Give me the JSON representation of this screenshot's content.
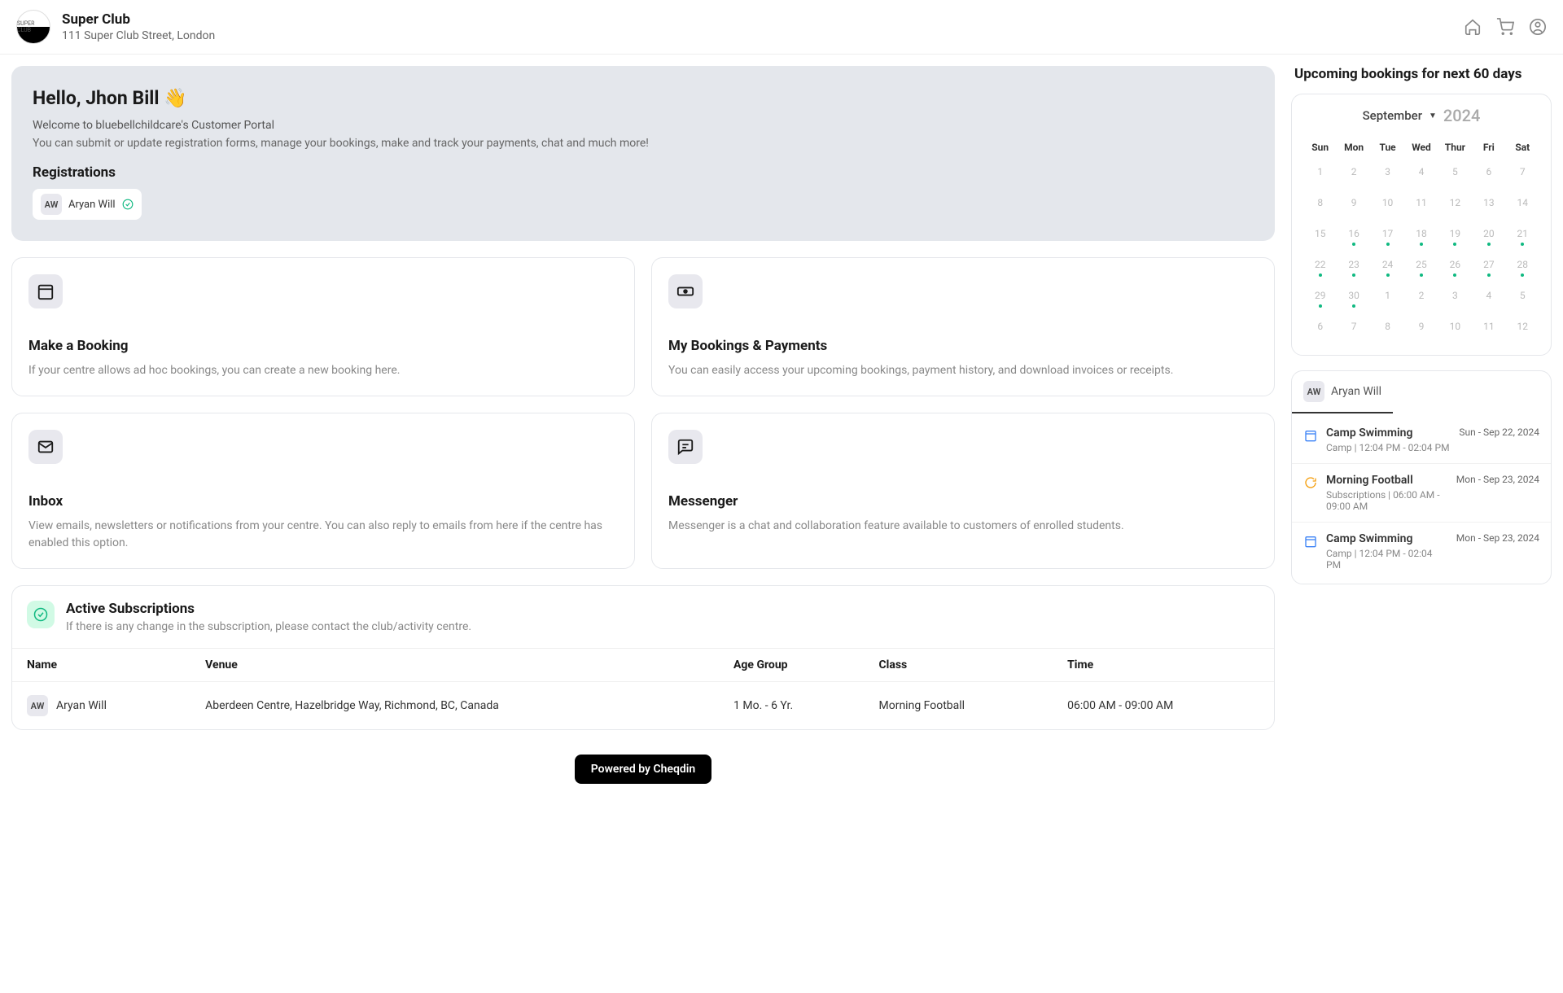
{
  "header": {
    "org_name": "Super Club",
    "org_address": "111 Super Club Street, London"
  },
  "hero": {
    "hello": "Hello, Jhon Bill 👋",
    "welcome": "Welcome to bluebellchildcare's Customer Portal",
    "welcome_sub": "You can submit or update registration forms, manage your bookings, make and track your payments, chat and much more!",
    "reg_title": "Registrations",
    "reg_initials": "AW",
    "reg_name": "Aryan Will"
  },
  "cards": [
    {
      "title": "Make a Booking",
      "desc": "If your centre allows ad hoc bookings, you can create a new booking here."
    },
    {
      "title": "My Bookings & Payments",
      "desc": "You can easily access your upcoming bookings, payment history, and download invoices or receipts."
    },
    {
      "title": "Inbox",
      "desc": "View emails, newsletters or notifications from your centre. You can also reply to emails from here if the centre has enabled this option."
    },
    {
      "title": "Messenger",
      "desc": "Messenger is a chat and collaboration feature available to customers of enrolled students."
    }
  ],
  "subs": {
    "title": "Active Subscriptions",
    "subtitle": "If there is any change in the subscription, please contact the club/activity centre.",
    "cols": {
      "name": "Name",
      "venue": "Venue",
      "age": "Age Group",
      "class": "Class",
      "time": "Time"
    },
    "rows": [
      {
        "initials": "AW",
        "name": "Aryan Will",
        "venue": "Aberdeen Centre, Hazelbridge Way, Richmond, BC, Canada",
        "age": "1 Mo. - 6 Yr.",
        "class": "Morning Football",
        "time": "06:00 AM - 09:00 AM"
      }
    ]
  },
  "powered": "Powered by Cheqdin",
  "side": {
    "title": "Upcoming bookings for next 60 days",
    "month": "September",
    "year": "2024",
    "dayhead": [
      "Sun",
      "Mon",
      "Tue",
      "Wed",
      "Thur",
      "Fri",
      "Sat"
    ],
    "weeks": [
      [
        {
          "n": 1
        },
        {
          "n": 2
        },
        {
          "n": 3
        },
        {
          "n": 4
        },
        {
          "n": 5
        },
        {
          "n": 6
        },
        {
          "n": 7
        }
      ],
      [
        {
          "n": 8
        },
        {
          "n": 9
        },
        {
          "n": 10
        },
        {
          "n": 11
        },
        {
          "n": 12
        },
        {
          "n": 13
        },
        {
          "n": 14
        }
      ],
      [
        {
          "n": 15
        },
        {
          "n": 16,
          "dot": true
        },
        {
          "n": 17,
          "dot": true
        },
        {
          "n": 18,
          "dot": true
        },
        {
          "n": 19,
          "dot": true
        },
        {
          "n": 20,
          "dot": true
        },
        {
          "n": 21,
          "dot": true
        }
      ],
      [
        {
          "n": 22,
          "dot": true
        },
        {
          "n": 23,
          "dot": true
        },
        {
          "n": 24,
          "dot": true
        },
        {
          "n": 25,
          "dot": true
        },
        {
          "n": 26,
          "dot": true
        },
        {
          "n": 27,
          "dot": true
        },
        {
          "n": 28,
          "dot": true
        }
      ],
      [
        {
          "n": 29,
          "dot": true
        },
        {
          "n": 30,
          "dot": true
        },
        {
          "n": 1
        },
        {
          "n": 2
        },
        {
          "n": 3
        },
        {
          "n": 4
        },
        {
          "n": 5
        }
      ],
      [
        {
          "n": 6
        },
        {
          "n": 7
        },
        {
          "n": 8
        },
        {
          "n": 9
        },
        {
          "n": 10
        },
        {
          "n": 11
        },
        {
          "n": 12
        }
      ]
    ],
    "tab_initials": "AW",
    "tab_name": "Aryan Will",
    "bookings": [
      {
        "icon": "blue",
        "title": "Camp Swimming",
        "meta": "Camp | 12:04 PM - 02:04 PM",
        "date": "Sun - Sep 22, 2024"
      },
      {
        "icon": "orange",
        "title": "Morning Football",
        "meta": "Subscriptions | 06:00 AM - 09:00 AM",
        "date": "Mon - Sep 23, 2024"
      },
      {
        "icon": "blue",
        "title": "Camp Swimming",
        "meta": "Camp | 12:04 PM - 02:04 PM",
        "date": "Mon - Sep 23, 2024"
      }
    ]
  }
}
